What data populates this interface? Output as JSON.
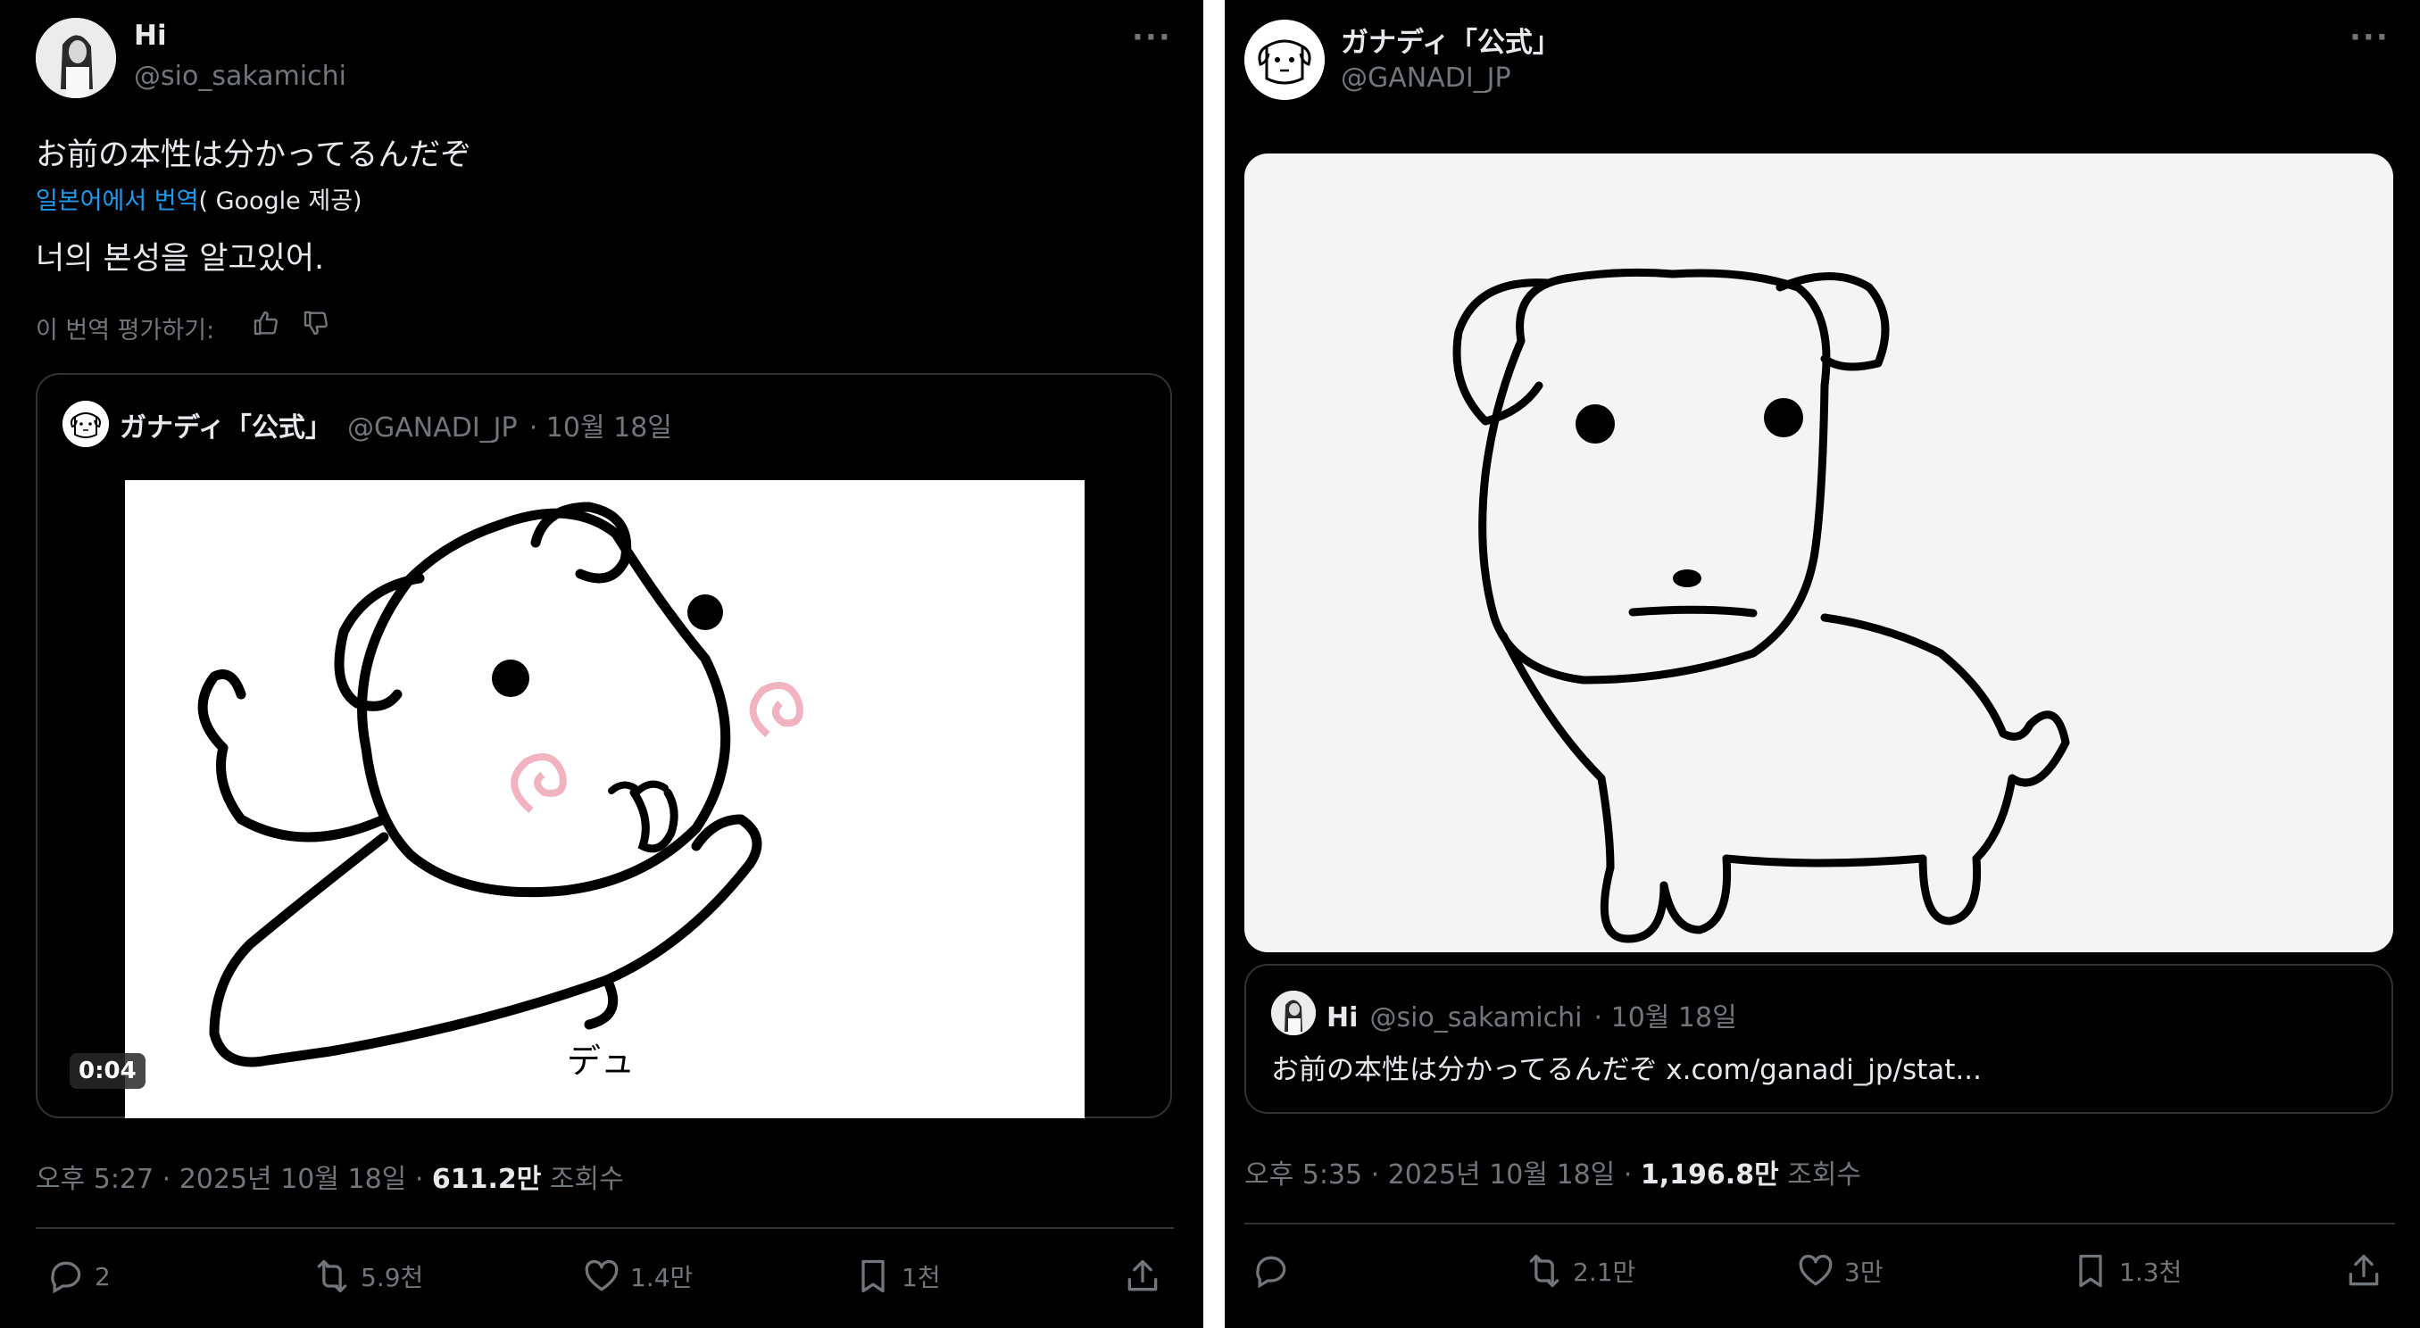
{
  "left_tweet": {
    "author_name": "Hi",
    "author_handle": "@sio_sakamichi",
    "more_label": "···",
    "text": "お前の本性は分かってるんだぞ",
    "translate_link": "일본어에서 번역",
    "translate_provider": "( Google 제공)",
    "translation": "너의 본성을 알고있어.",
    "rate_label": "이 번역 평가하기:",
    "quote": {
      "author_name": "ガナディ「公式」",
      "author_handle": "@GANADI_JP",
      "date": "· 10월 18일",
      "video_time": "0:04",
      "video_caption": "デュ"
    },
    "meta_time": "오후 5:27 · 2025년 10월 18일 ·",
    "views": "611.2만",
    "views_label": "조회수",
    "actions": {
      "replies": "2",
      "reposts": "5.9천",
      "likes": "1.4만",
      "bookmarks": "1천"
    }
  },
  "right_tweet": {
    "author_name": "ガナディ「公式」",
    "author_handle": "@GANADI_JP",
    "more_label": "···",
    "quote": {
      "author_name": "Hi",
      "author_handle": "@sio_sakamichi",
      "date": "· 10월 18일",
      "text": "お前の本性は分かってるんだぞ x.com/ganadi_jp/stat..."
    },
    "meta_time": "오후 5:35 · 2025년 10월 18일 ·",
    "views": "1,196.8만",
    "views_label": "조회수",
    "actions": {
      "replies": "",
      "reposts": "2.1만",
      "likes": "3만",
      "bookmarks": "1.3천"
    }
  },
  "icons": [
    "thumbs-up-icon",
    "thumbs-down-icon",
    "reply-icon",
    "repost-icon",
    "like-icon",
    "bookmark-icon",
    "share-icon"
  ]
}
